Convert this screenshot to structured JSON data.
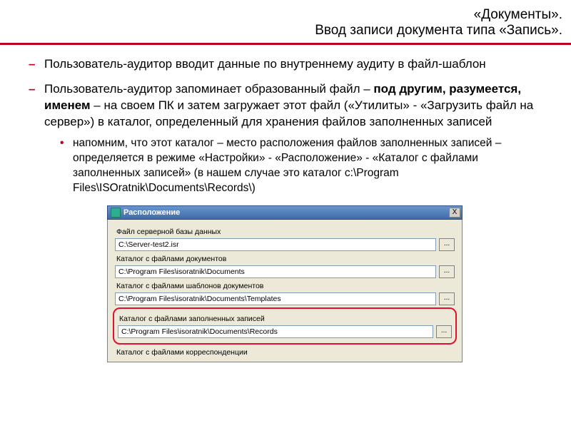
{
  "header": {
    "line1": "«Документы».",
    "line2": "Ввод записи документа типа «Запись»."
  },
  "bullets": {
    "b1": "Пользователь-аудитор вводит данные по внутреннему аудиту в файл-шаблон",
    "b2_pre": "Пользователь-аудитор запоминает образованный файл – ",
    "b2_bold": "под другим, разумеется, именем",
    "b2_post": " – на своем ПК и затем загружает этот файл («Утилиты» - «Загрузить файл на сервер») в каталог, определенный для хранения файлов заполненных записей",
    "sub1": "напомним, что этот каталог – место расположения файлов заполненных записей – определяется в режиме «Настройки» - «Расположение» - «Каталог с файлами заполненных записей» (в нашем случае это каталог c:\\Program Files\\ISOratnik\\Documents\\Records\\)"
  },
  "dialog": {
    "title": "Расположение",
    "close": "X",
    "browse": "...",
    "f1_label": "Файл серверной базы данных",
    "f1_value": "C:\\Server-test2.isr",
    "f2_label": "Каталог с файлами документов",
    "f2_value": "C:\\Program Files\\isoratnik\\Documents",
    "f3_label": "Каталог с файлами шаблонов документов",
    "f3_value": "C:\\Program Files\\isoratnik\\Documents\\Templates",
    "f4_label": "Каталог с файлами заполненных записей",
    "f4_value": "C:\\Program Files\\isoratnik\\Documents\\Records",
    "f5_label": "Каталог с файлами корреспонденции"
  }
}
